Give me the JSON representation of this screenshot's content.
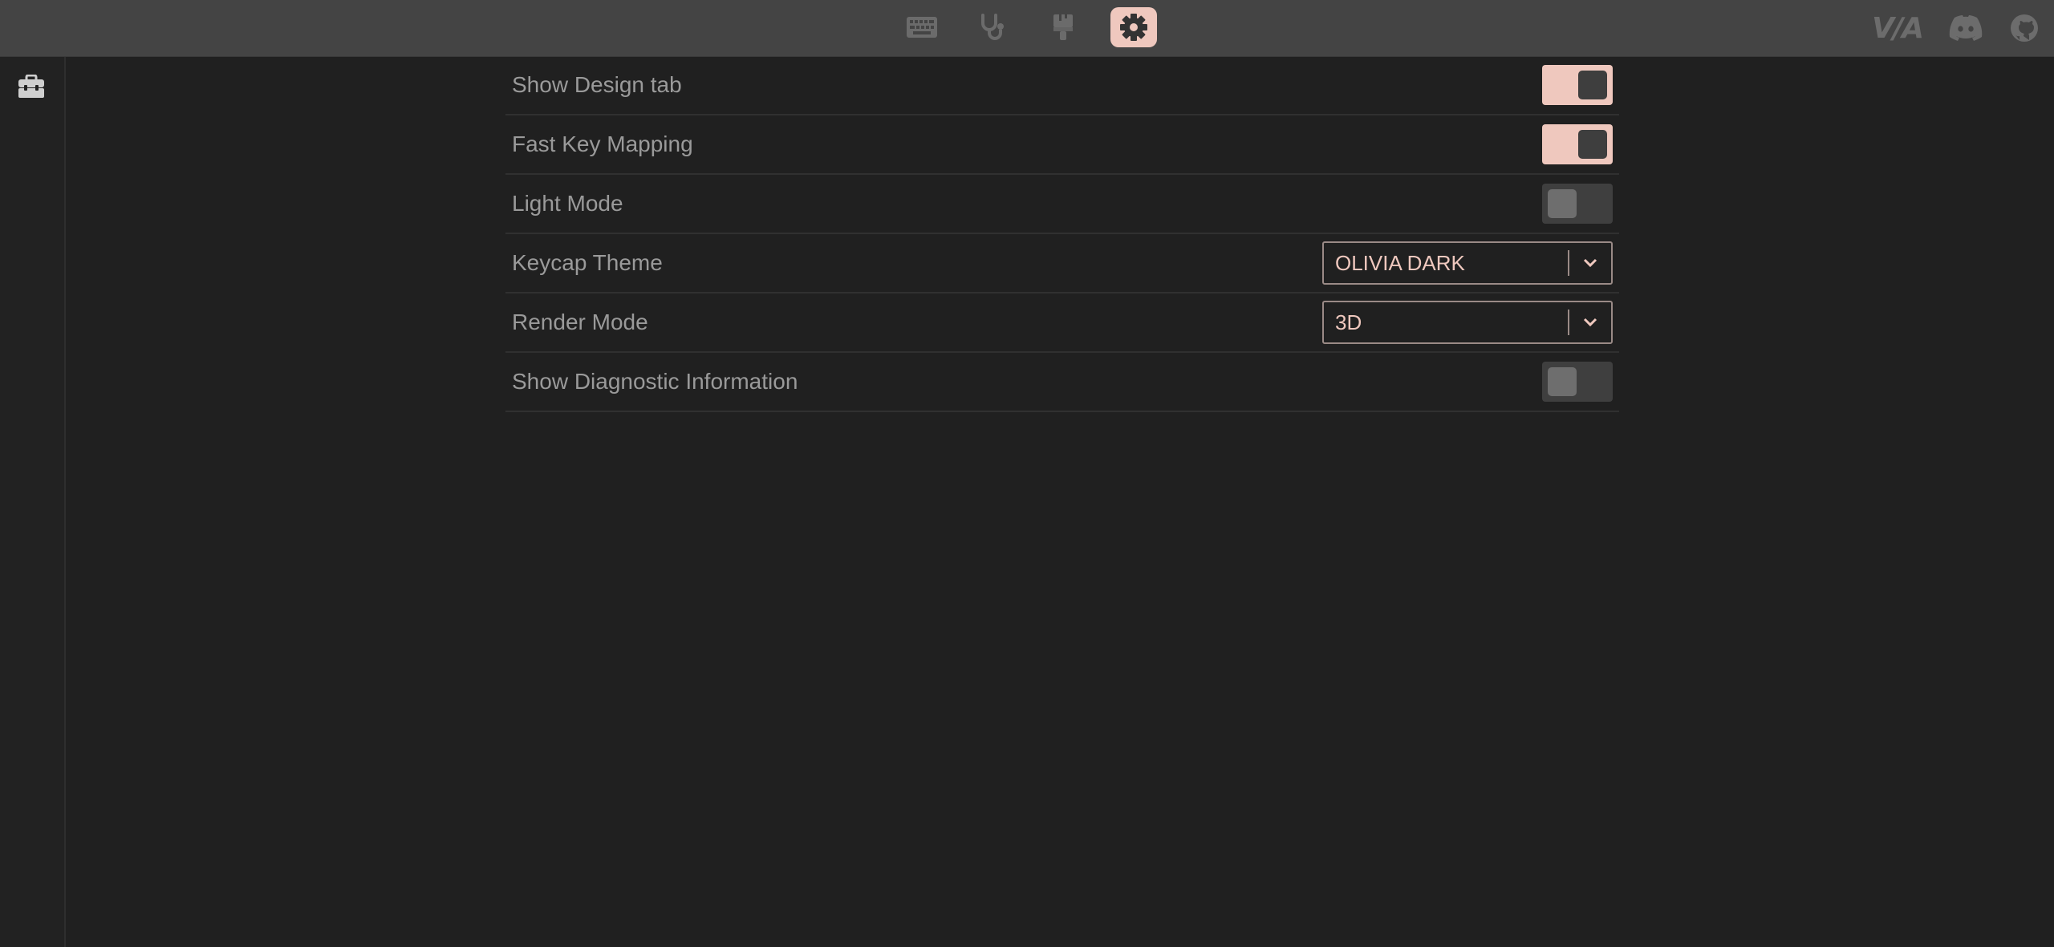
{
  "topnav": {
    "items": [
      {
        "icon": "keyboard-icon",
        "active": false
      },
      {
        "icon": "stethoscope-icon",
        "active": false
      },
      {
        "icon": "paintbrush-icon",
        "active": false
      },
      {
        "icon": "gear-icon",
        "active": true
      }
    ],
    "logo_text": "V/A",
    "links": [
      "discord-icon",
      "github-icon"
    ]
  },
  "sidebar": {
    "icon": "toolbox-icon"
  },
  "settings": {
    "show_design_tab": {
      "label": "Show Design tab",
      "enabled": true
    },
    "fast_key_mapping": {
      "label": "Fast Key Mapping",
      "enabled": true
    },
    "light_mode": {
      "label": "Light Mode",
      "enabled": false
    },
    "keycap_theme": {
      "label": "Keycap Theme",
      "value": "OLIVIA DARK"
    },
    "render_mode": {
      "label": "Render Mode",
      "value": "3D"
    },
    "show_diagnostic": {
      "label": "Show Diagnostic Information",
      "enabled": false
    }
  },
  "colors": {
    "accent": "#efc8be",
    "background": "#202020",
    "topbar": "#444444"
  }
}
